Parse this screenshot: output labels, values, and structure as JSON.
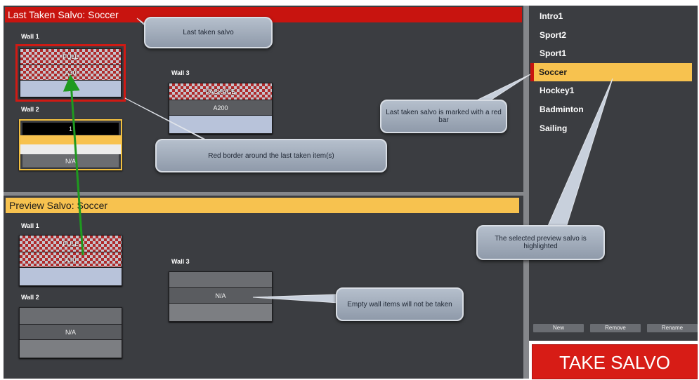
{
  "last_taken": {
    "title": "Last Taken Salvo: Soccer",
    "walls": [
      {
        "label": "Wall 1",
        "rows": [
          "FULL",
          "A30",
          ""
        ]
      },
      {
        "label": "Wall 2",
        "rows": [
          "1",
          "",
          "",
          "N/A"
        ]
      },
      {
        "label": "Wall 3",
        "rows": [
          "PACKAGE",
          "A200",
          ""
        ]
      }
    ]
  },
  "preview": {
    "title": "Preview Salvo: Soccer",
    "walls": [
      {
        "label": "Wall 1",
        "rows": [
          "FULL",
          "A30",
          ""
        ]
      },
      {
        "label": "Wall 2",
        "rows": [
          "",
          "N/A",
          ""
        ]
      },
      {
        "label": "Wall 3",
        "rows": [
          "",
          "N/A",
          ""
        ]
      }
    ]
  },
  "salvos": [
    "Intro1",
    "Sport2",
    "Sport1",
    "Soccer",
    "Hockey1",
    "Badminton",
    "Sailing"
  ],
  "selected_salvo": "Soccer",
  "buttons": {
    "new": "New",
    "remove": "Remove",
    "rename": "Rename",
    "take": "TAKE SALVO"
  },
  "callouts": {
    "last_taken": "Last taken salvo",
    "red_bar": "Last taken salvo is marked with a red bar",
    "red_border": "Red border around the last taken item(s)",
    "highlighted": "The selected preview salvo is highlighted",
    "empty_items": "Empty wall items will not be taken"
  },
  "colors": {
    "red": "#c8140f",
    "yellow": "#f7c24f",
    "panel": "#3b3d41",
    "arrow_green": "#1f9a1f"
  }
}
